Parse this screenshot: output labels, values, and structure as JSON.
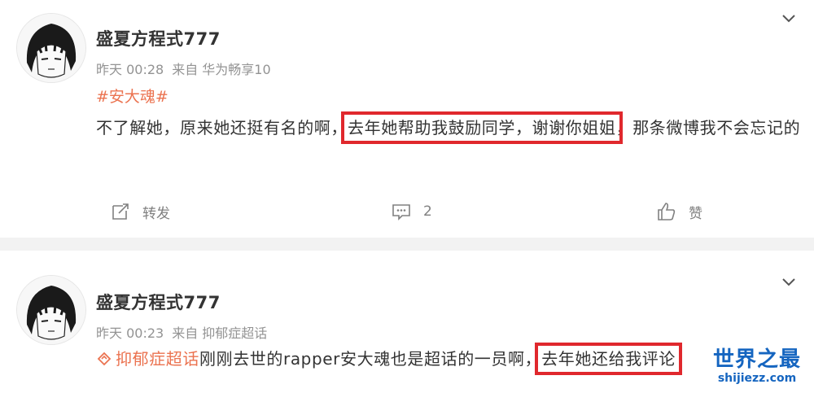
{
  "posts": [
    {
      "username": "盛夏方程式777",
      "time": "昨天 00:28",
      "source": "来自 华为畅享10",
      "topic": "#安大魂#",
      "text_before": "不了解她，原来她还挺有名的啊，",
      "text_highlight": "去年她帮助我鼓励同学，谢谢你姐姐",
      "text_after": "，那条微博我不会忘记的",
      "actions": {
        "repost_label": "转发",
        "comment_count": "2",
        "like_label": "赞"
      }
    },
    {
      "username": "盛夏方程式777",
      "time": "昨天 00:23",
      "source": "来自 抑郁症超话",
      "super_topic": "抑郁症超话",
      "text_before": "刚刚去世的rapper安大魂也是超话的一员啊，",
      "text_highlight": "去年她还给我评论"
    }
  ],
  "watermark": {
    "main": "世界之最",
    "sub": "shijiezz.com"
  },
  "colors": {
    "accent": "#eb7350",
    "highlight_box": "#e0282d",
    "meta_gray": "#939393",
    "watermark_blue": "#1565c0"
  },
  "icons": [
    "avatar-image",
    "chevron-down-icon",
    "repost-icon",
    "comment-icon",
    "like-icon",
    "super-topic-icon"
  ]
}
